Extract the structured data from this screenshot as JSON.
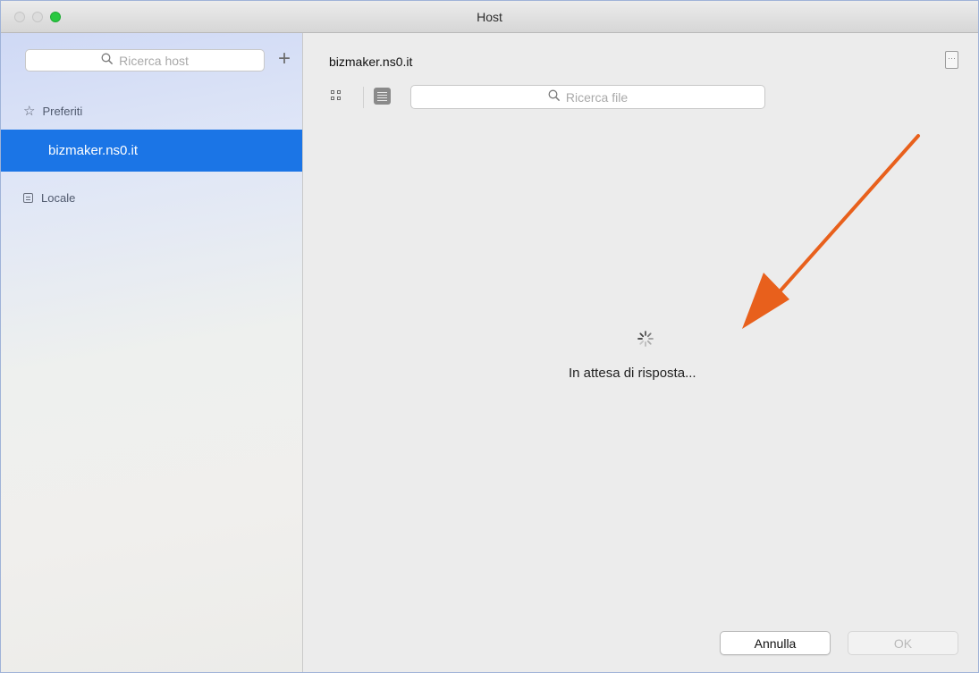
{
  "window": {
    "title": "Host"
  },
  "sidebar": {
    "search_placeholder": "Ricerca host",
    "add_label": "+",
    "favorites_label": "Preferiti",
    "favorites_items": [
      {
        "label": "bizmaker.ns0.it",
        "selected": true
      }
    ],
    "local_label": "Locale",
    "selected_color": "#1b75e6"
  },
  "main": {
    "host_name": "bizmaker.ns0.it",
    "search_placeholder": "Ricerca file",
    "status_text": "In attesa di risposta...",
    "annotation_arrow_color": "#e8601c"
  },
  "buttons": {
    "cancel": "Annulla",
    "ok": "OK"
  }
}
